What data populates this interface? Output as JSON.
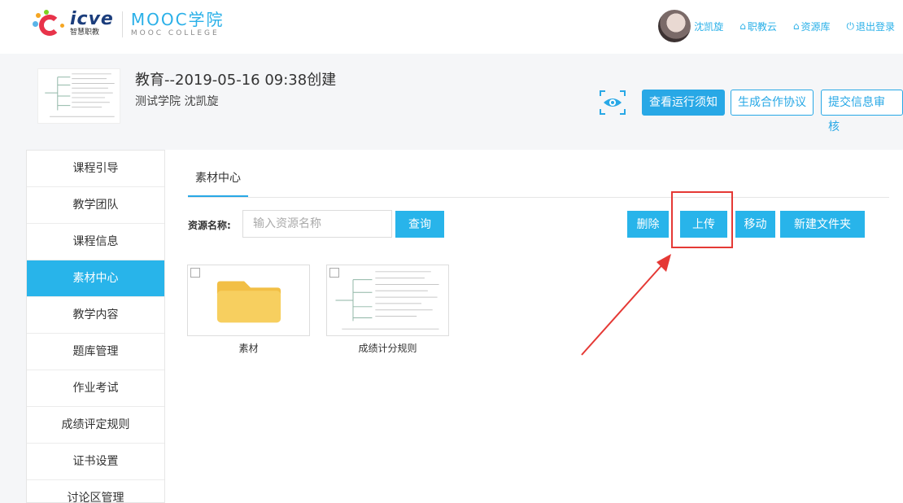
{
  "brand": {
    "logo_text": "icve",
    "logo_sub": "智慧职教",
    "title": "MOOC学院",
    "subtitle": "MOOC COLLEGE"
  },
  "user": {
    "name": "沈凯旋",
    "links": [
      {
        "label": "职教云",
        "icon": "home-icon"
      },
      {
        "label": "资源库",
        "icon": "home-icon"
      },
      {
        "label": "退出登录",
        "icon": "power-icon"
      }
    ]
  },
  "course": {
    "title": "教育--2019-05-16 09:38创建",
    "subtitle": "测试学院  沈凯旋",
    "buttons": {
      "view_notice": "查看运行须知",
      "generate_agreement": "生成合作协议",
      "submit_review": "提交信息审核"
    }
  },
  "sidebar": {
    "items": [
      {
        "label": "课程引导",
        "active": false
      },
      {
        "label": "教学团队",
        "active": false
      },
      {
        "label": "课程信息",
        "active": false
      },
      {
        "label": "素材中心",
        "active": true
      },
      {
        "label": "教学内容",
        "active": false
      },
      {
        "label": "题库管理",
        "active": false
      },
      {
        "label": "作业考试",
        "active": false
      },
      {
        "label": "成绩评定规则",
        "active": false
      },
      {
        "label": "证书设置",
        "active": false
      },
      {
        "label": "讨论区管理",
        "active": false
      }
    ]
  },
  "main": {
    "tab": "素材中心",
    "search": {
      "label": "资源名称:",
      "placeholder": "输入资源名称",
      "button": "查询"
    },
    "toolbar": {
      "delete": "删除",
      "upload": "上传",
      "move": "移动",
      "new_folder": "新建文件夹"
    },
    "files": [
      {
        "name": "素材",
        "type": "folder"
      },
      {
        "name": "成绩计分规则",
        "type": "image"
      }
    ]
  },
  "colors": {
    "accent": "#28b4ea",
    "annotation": "#e53935",
    "folder": "#f7cf5f"
  }
}
